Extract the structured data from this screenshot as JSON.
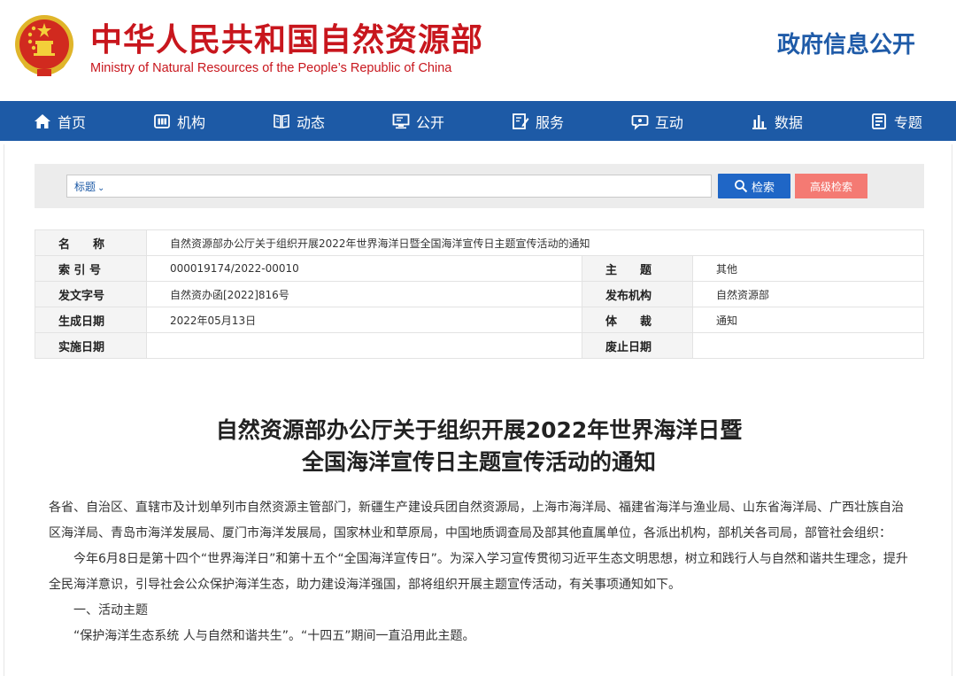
{
  "header": {
    "title_cn": "中华人民共和国自然资源部",
    "title_en": "Ministry of Natural Resources of the People’s Republic of China",
    "gov_info": "政府信息公开"
  },
  "nav": [
    {
      "label": "首页",
      "icon": "home-icon"
    },
    {
      "label": "机构",
      "icon": "org-icon"
    },
    {
      "label": "动态",
      "icon": "book-icon"
    },
    {
      "label": "公开",
      "icon": "monitor-icon"
    },
    {
      "label": "服务",
      "icon": "edit-icon"
    },
    {
      "label": "互动",
      "icon": "chat-icon"
    },
    {
      "label": "数据",
      "icon": "chart-icon"
    },
    {
      "label": "专题",
      "icon": "doc-icon"
    }
  ],
  "search": {
    "type_label": "标题",
    "search_label": "检索",
    "advanced_label": "高级检索"
  },
  "info": {
    "name_label": "名　　称",
    "name_value": "自然资源部办公厅关于组织开展2022年世界海洋日暨全国海洋宣传日主题宣传活动的通知",
    "index_label": "索 引 号",
    "index_value": "000019174/2022-00010",
    "theme_label": "主　　题",
    "theme_value": "其他",
    "doc_no_label": "发文字号",
    "doc_no_value": "自然资办函[2022]816号",
    "publisher_label": "发布机构",
    "publisher_value": "自然资源部",
    "date_label": "生成日期",
    "date_value": "2022年05月13日",
    "genre_label": "体　　裁",
    "genre_value": "通知",
    "impl_label": "实施日期",
    "impl_value": "",
    "abolish_label": "废止日期",
    "abolish_value": ""
  },
  "article": {
    "title_line1": "自然资源部办公厅关于组织开展2022年世界海洋日暨",
    "title_line2": "全国海洋宣传日主题宣传活动的通知",
    "addressee": "各省、自治区、直辖市及计划单列市自然资源主管部门，新疆生产建设兵团自然资源局，上海市海洋局、福建省海洋与渔业局、山东省海洋局、广西壮族自治区海洋局、青岛市海洋发展局、厦门市海洋发展局，国家林业和草原局，中国地质调查局及部其他直属单位，各派出机构，部机关各司局，部管社会组织：",
    "para1": "今年6月8日是第十四个“世界海洋日”和第十五个“全国海洋宣传日”。为深入学习宣传贯彻习近平生态文明思想，树立和践行人与自然和谐共生理念，提升全民海洋意识，引导社会公众保护海洋生态，助力建设海洋强国，部将组织开展主题宣传活动，有关事项通知如下。",
    "section1": "一、活动主题",
    "theme_text": "“保护海洋生态系统 人与自然和谐共生”。“十四五”期间一直沿用此主题。"
  },
  "colors": {
    "brand_red": "#c8161d",
    "nav_blue": "#1d5aa6",
    "search_blue": "#1f66c6",
    "advanced_pink": "#f47a73"
  }
}
